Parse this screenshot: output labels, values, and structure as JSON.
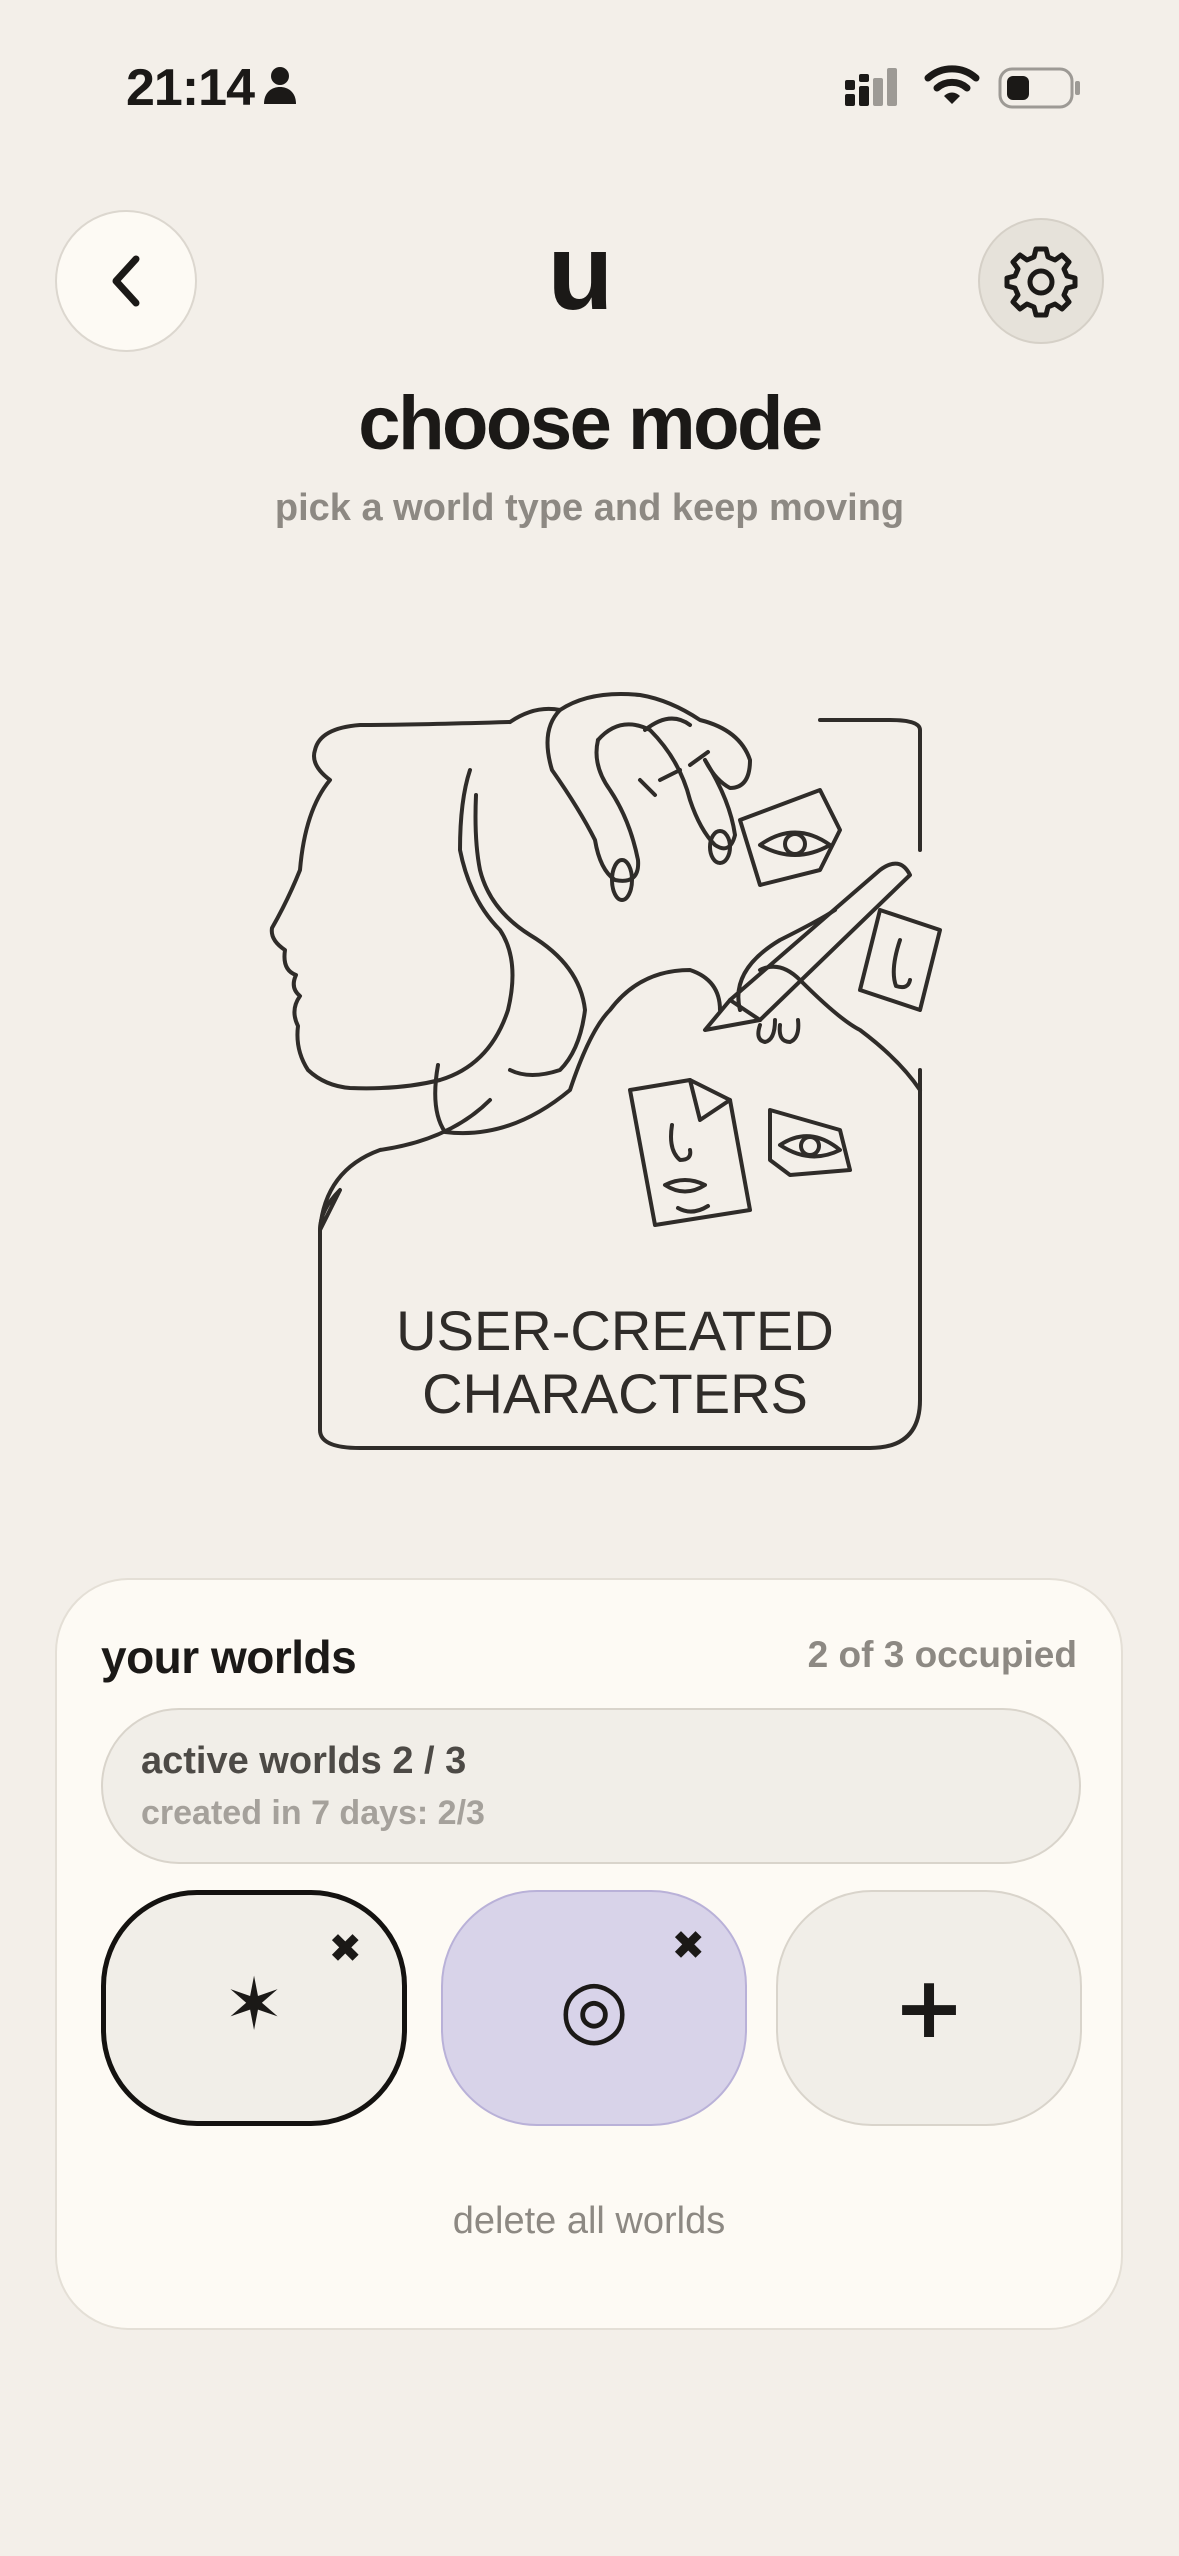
{
  "status_bar": {
    "time": "21:14"
  },
  "header": {
    "logo": "u"
  },
  "page": {
    "title": "choose mode",
    "subtitle": "pick a world type and keep moving"
  },
  "illustration": {
    "caption_line1": "USER-CREATED",
    "caption_line2": "CHARACTERS"
  },
  "worlds": {
    "title": "your worlds",
    "occupied": "2 of 3 occupied",
    "active_title": "active worlds 2 / 3",
    "active_sub": "created in 7 days: 2/3",
    "slots": [
      {
        "glyph": "✶",
        "close": "✖",
        "icon": "star-icon",
        "selected": true
      },
      {
        "glyph": "◎",
        "close": "✖",
        "icon": "target-icon",
        "accent": "#d8d3e9"
      },
      {
        "glyph": "+",
        "icon": "plus-icon"
      }
    ],
    "delete_all": "delete all worlds"
  }
}
